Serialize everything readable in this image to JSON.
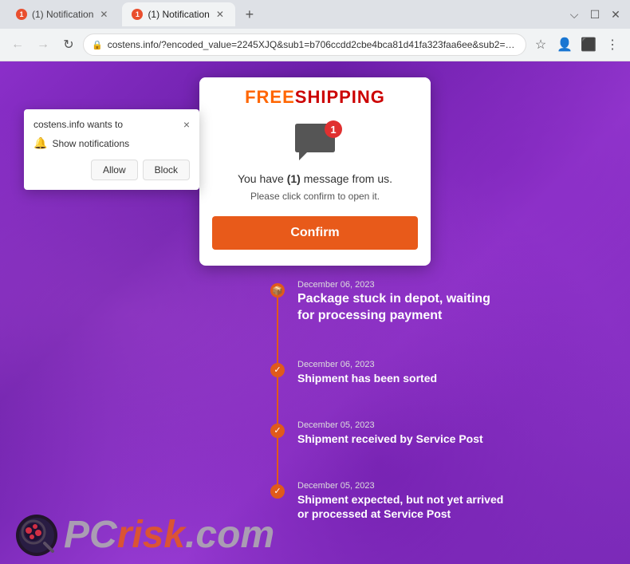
{
  "browser": {
    "tabs": [
      {
        "id": "tab1",
        "favicon_label": "1",
        "label": "(1) Notification",
        "active": false
      },
      {
        "id": "tab2",
        "favicon_label": "1",
        "label": "(1) Notification",
        "active": true
      }
    ],
    "new_tab_label": "+",
    "address_bar": {
      "url": "costens.info/?encoded_value=2245XJQ&sub1=b706ccdd2cbe4bca81d41fa323faa6ee&sub2=426415&sub3=&sub4=&sub5=13135&s..."
    },
    "window_controls": {
      "minimize": "—",
      "maximize": "☐",
      "close": "✕"
    }
  },
  "notification_popup": {
    "title": "costens.info wants to",
    "permission_text": "Show notifications",
    "allow_label": "Allow",
    "block_label": "Block",
    "close_label": "×"
  },
  "main_card": {
    "free_text": "FREE",
    "shipping_text": "SHIPPING",
    "badge_number": "1",
    "message_line1": "You have ",
    "message_highlight": "(1)",
    "message_line2": " message from us.",
    "message_sub": "Please click confirm to open it.",
    "confirm_label": "Confirm"
  },
  "timeline": {
    "items": [
      {
        "date": "December 06, 2023",
        "title": "Package stuck in depot, waiting for processing payment",
        "large": true,
        "icon": "box"
      },
      {
        "date": "December 06, 2023",
        "title": "Shipment has been sorted",
        "large": false,
        "icon": "check"
      },
      {
        "date": "December 05, 2023",
        "title": "Shipment received by Service Post",
        "large": false,
        "icon": "check"
      },
      {
        "date": "December 05, 2023",
        "title": "Shipment expected, but not yet arrived or processed at Service Post",
        "large": false,
        "icon": "check"
      }
    ]
  },
  "pcrisk": {
    "pc_text": "PC",
    "risk_text": "risk",
    "domain": ".com"
  }
}
